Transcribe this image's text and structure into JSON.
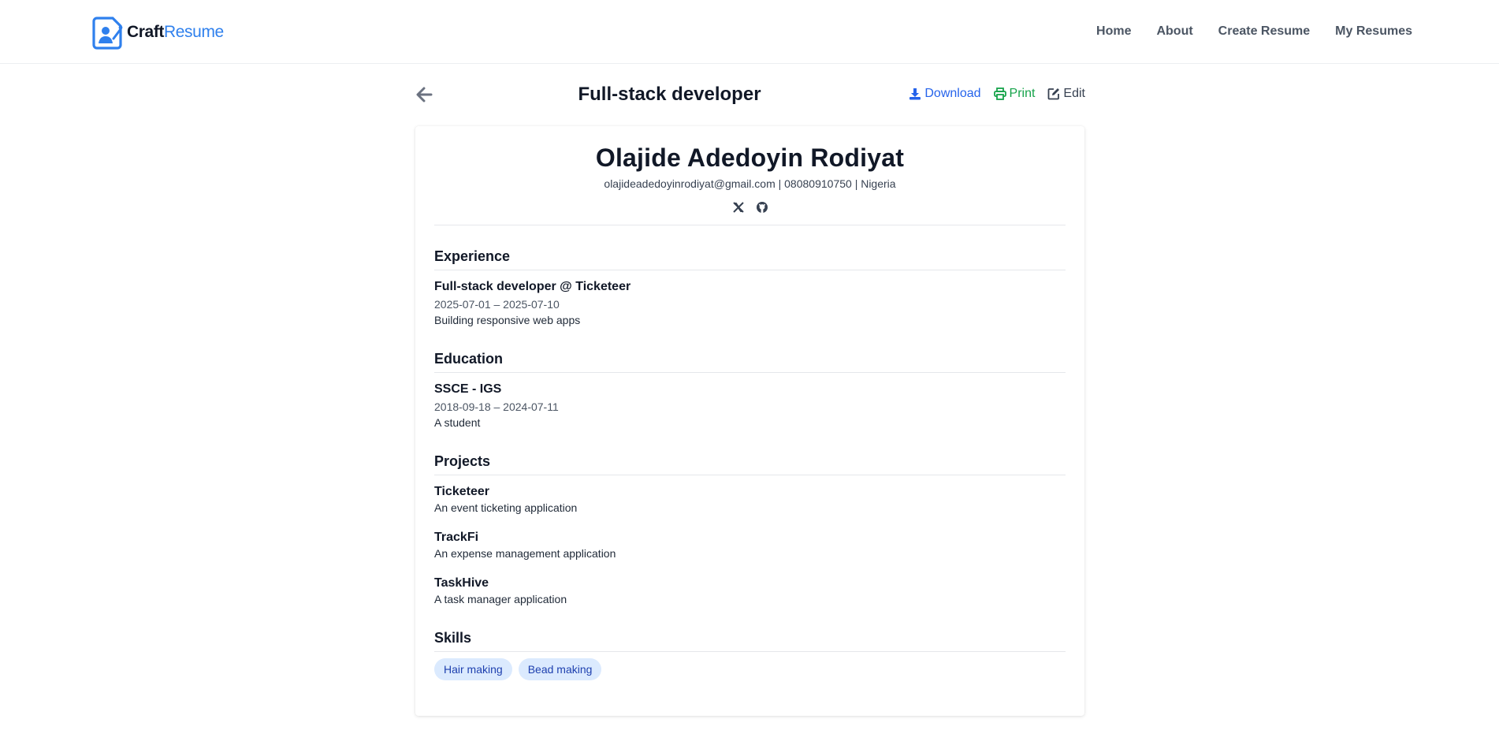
{
  "brand": {
    "part1": "Craft",
    "part2": "Resume",
    "icon": "resume-logo-icon",
    "accent_color": "#2f80ed"
  },
  "nav": {
    "items": [
      {
        "label": "Home"
      },
      {
        "label": "About"
      },
      {
        "label": "Create Resume"
      },
      {
        "label": "My Resumes"
      }
    ]
  },
  "resume_header": {
    "title": "Full-stack developer",
    "back_icon": "arrow-left-icon",
    "actions": {
      "download": {
        "label": "Download",
        "icon": "download-icon",
        "color": "#2563eb"
      },
      "print": {
        "label": "Print",
        "icon": "printer-icon",
        "color": "#16a34a"
      },
      "edit": {
        "label": "Edit",
        "icon": "edit-icon",
        "color": "#374151"
      }
    }
  },
  "resume": {
    "name": "Olajide Adedoyin Rodiyat",
    "contact": "olajideadedoyinrodiyat@gmail.com | 08080910750 | Nigeria",
    "socials": [
      "x-twitter-icon",
      "github-icon"
    ],
    "experience": {
      "title": "Experience",
      "items": [
        {
          "title": "Full-stack developer @ Ticketeer",
          "dates": "2025-07-01 – 2025-07-10",
          "description": "Building responsive web apps"
        }
      ]
    },
    "education": {
      "title": "Education",
      "items": [
        {
          "title": "SSCE - IGS",
          "dates": "2018-09-18 – 2024-07-11",
          "description": "A student"
        }
      ]
    },
    "projects": {
      "title": "Projects",
      "items": [
        {
          "title": "Ticketeer",
          "description": "An event ticketing application"
        },
        {
          "title": "TrackFi",
          "description": "An expense management application"
        },
        {
          "title": "TaskHive",
          "description": "A task manager application"
        }
      ]
    },
    "skills": {
      "title": "Skills",
      "items": [
        "Hair making",
        "Bead making"
      ],
      "chip_bg": "#dbeafe",
      "chip_text": "#1e40af"
    }
  }
}
